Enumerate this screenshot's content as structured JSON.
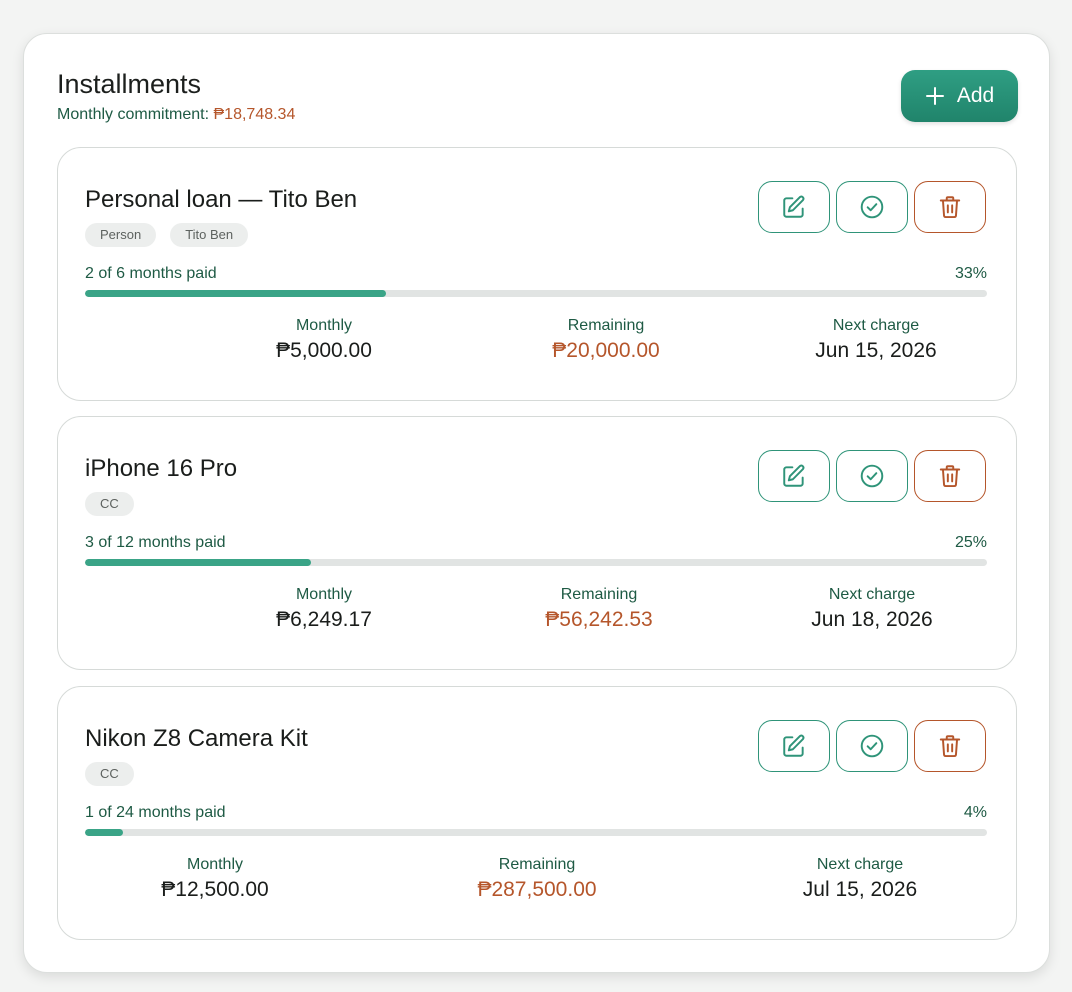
{
  "header": {
    "title": "Installments",
    "commitment_label": "Monthly commitment:",
    "commitment_amount": "₱18,748.34",
    "add_label": "Add"
  },
  "labels": {
    "monthly": "Monthly",
    "remaining": "Remaining",
    "next_charge": "Next charge"
  },
  "icons": {
    "add": "plus-icon",
    "edit": "edit-icon",
    "mark_paid": "check-circle-icon",
    "delete": "trash-icon"
  },
  "colors": {
    "accent_green": "#2f9479",
    "accent_orange": "#b5562b",
    "text_green": "#1e5a44",
    "progress_fill": "#3aa487"
  },
  "installments": [
    {
      "title": "Personal loan — Tito Ben",
      "tags": [
        "Person",
        "Tito Ben"
      ],
      "progress_text": "2 of 6 months paid",
      "percent_label": "33%",
      "progress": 0.3333,
      "monthly": "₱5,000.00",
      "remaining": "₱20,000.00",
      "next_charge": "Jun 15, 2026"
    },
    {
      "title": "iPhone 16 Pro",
      "tags": [
        "CC"
      ],
      "progress_text": "3 of 12 months paid",
      "percent_label": "25%",
      "progress": 0.25,
      "monthly": "₱6,249.17",
      "remaining": "₱56,242.53",
      "next_charge": "Jun 18, 2026"
    },
    {
      "title": "Nikon Z8 Camera Kit",
      "tags": [
        "CC"
      ],
      "progress_text": "1 of 24 months paid",
      "percent_label": "4%",
      "progress": 0.0417,
      "monthly": "₱12,500.00",
      "remaining": "₱287,500.00",
      "next_charge": "Jul 15, 2026"
    }
  ]
}
